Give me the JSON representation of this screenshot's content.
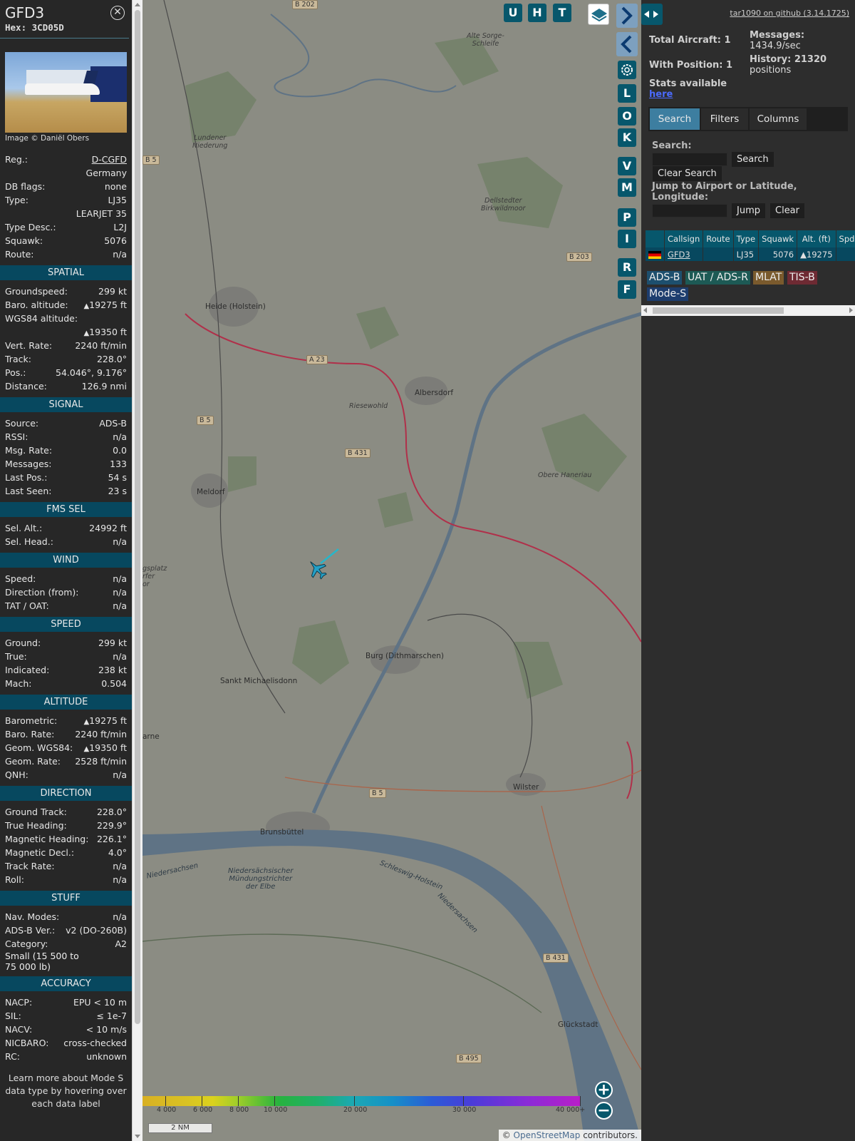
{
  "aircraft": {
    "callsign": "GFD3",
    "hex_label": "Hex:",
    "hex": "3CD05D",
    "photo_caption": "Image © Daniël Obers"
  },
  "info": [
    {
      "k": "Reg.:",
      "v": "D-CGFD",
      "link": true
    },
    {
      "k": "",
      "v": "Germany"
    },
    {
      "k": "DB flags:",
      "v": "none"
    },
    {
      "k": "Type:",
      "v": "LJ35"
    },
    {
      "k": "",
      "v": "LEARJET 35"
    },
    {
      "k": "Type Desc.:",
      "v": "L2J"
    },
    {
      "k": "Squawk:",
      "v": "5076"
    },
    {
      "k": "Route:",
      "v": "n/a"
    }
  ],
  "sections": {
    "spatial": {
      "title": "SPATIAL",
      "rows": [
        {
          "k": "Groundspeed:",
          "v": "299 kt"
        },
        {
          "k": "Baro. altitude:",
          "v": "▲19275 ft"
        },
        {
          "k": "WGS84 altitude:",
          "v": ""
        },
        {
          "k": "",
          "v": "▲19350 ft"
        },
        {
          "k": "Vert. Rate:",
          "v": "2240 ft/min"
        },
        {
          "k": "Track:",
          "v": "228.0°"
        },
        {
          "k": "Pos.:",
          "v": "54.046°, 9.176°"
        },
        {
          "k": "Distance:",
          "v": "126.9 nmi"
        }
      ]
    },
    "signal": {
      "title": "SIGNAL",
      "rows": [
        {
          "k": "Source:",
          "v": "ADS-B"
        },
        {
          "k": "RSSI:",
          "v": "n/a"
        },
        {
          "k": "Msg. Rate:",
          "v": "0.0"
        },
        {
          "k": "Messages:",
          "v": "133"
        },
        {
          "k": "Last Pos.:",
          "v": "54 s"
        },
        {
          "k": "Last Seen:",
          "v": "23 s"
        }
      ]
    },
    "fms": {
      "title": "FMS SEL",
      "rows": [
        {
          "k": "Sel. Alt.:",
          "v": "24992 ft"
        },
        {
          "k": "Sel. Head.:",
          "v": "n/a"
        }
      ]
    },
    "wind": {
      "title": "WIND",
      "rows": [
        {
          "k": "Speed:",
          "v": "n/a"
        },
        {
          "k": "Direction (from):",
          "v": "n/a"
        },
        {
          "k": "TAT / OAT:",
          "v": "n/a"
        }
      ]
    },
    "speed": {
      "title": "SPEED",
      "rows": [
        {
          "k": "Ground:",
          "v": "299 kt"
        },
        {
          "k": "True:",
          "v": "n/a"
        },
        {
          "k": "Indicated:",
          "v": "238 kt"
        },
        {
          "k": "Mach:",
          "v": "0.504"
        }
      ]
    },
    "altitude": {
      "title": "ALTITUDE",
      "rows": [
        {
          "k": "Barometric:",
          "v": "▲19275 ft"
        },
        {
          "k": "Baro. Rate:",
          "v": "2240 ft/min"
        },
        {
          "k": "Geom. WGS84:",
          "v": "▲19350 ft"
        },
        {
          "k": "Geom. Rate:",
          "v": "2528 ft/min"
        },
        {
          "k": "QNH:",
          "v": "n/a"
        }
      ]
    },
    "direction": {
      "title": "DIRECTION",
      "rows": [
        {
          "k": "Ground Track:",
          "v": "228.0°"
        },
        {
          "k": "True Heading:",
          "v": "229.9°"
        },
        {
          "k": "Magnetic Heading:",
          "v": "226.1°"
        },
        {
          "k": "Magnetic Decl.:",
          "v": "4.0°"
        },
        {
          "k": "Track Rate:",
          "v": "n/a"
        },
        {
          "k": "Roll:",
          "v": "n/a"
        }
      ]
    },
    "stuff": {
      "title": "STUFF",
      "rows": [
        {
          "k": "Nav. Modes:",
          "v": "n/a"
        },
        {
          "k": "ADS-B Ver.:",
          "v": "v2 (DO-260B)"
        },
        {
          "k": "Category:",
          "v": "A2"
        }
      ],
      "category_desc": "Small (15 500 to 75 000 lb)"
    },
    "accuracy": {
      "title": "ACCURACY",
      "rows": [
        {
          "k": "NACP:",
          "v": "EPU < 10 m"
        },
        {
          "k": "SIL:",
          "v": "≤ 1e-7"
        },
        {
          "k": "NACV:",
          "v": "< 10 m/s"
        },
        {
          "k": "NICBARO:",
          "v": "cross-checked"
        },
        {
          "k": "RC:",
          "v": "unknown"
        }
      ]
    }
  },
  "learn_more": "Learn more about Mode S data type by hovering over each data label",
  "map": {
    "buttons": [
      "U",
      "H",
      "T",
      "L",
      "O",
      "K",
      "V",
      "M",
      "P",
      "I",
      "R",
      "F"
    ],
    "places": {
      "heide": "Heide (Holstein)",
      "albersdorf": "Albersdorf",
      "meldorf": "Meldorf",
      "burg": "Burg (Dithmarschen)",
      "sankt": "Sankt Michaelisdonn",
      "wilster": "Wilster",
      "brunsbuettel": "Brunsbüttel",
      "glueckstadt": "Glückstadt",
      "marne": "arne",
      "lundener": "Lundener\nNiederung",
      "riesewohld": "Riesewohld",
      "dellstedter": "Dellstedter\nBirkwildmoor",
      "alte": "Alte Sorge-\nSchleife",
      "obere": "Obere Haneriau",
      "elbe": "Niedersächsischer\nMündungstrichter\nder Elbe",
      "sh": "Schleswig-Holstein",
      "nds1": "Niedersachsen",
      "nds2": "Niedersachsen",
      "platz": "gsplatz\nrfer\nor"
    },
    "roads": {
      "b202": "B 202",
      "b203": "B 203",
      "a23": "A 23",
      "b5a": "B 5",
      "b5b": "B 5",
      "b431a": "B 431",
      "b431b": "B 431",
      "b495": "B 495",
      "b5c": "B 5"
    },
    "legend_labels": [
      "4 000",
      "6 000",
      "8 000",
      "10 000",
      "20 000",
      "30 000",
      "40 000+"
    ],
    "scale": "2 NM",
    "attribution_prefix": "© ",
    "attribution_link": "OpenStreetMap",
    "attribution_suffix": " contributors."
  },
  "sidebar": {
    "github": "tar1090 on github (3.14.1725)",
    "total_aircraft": "Total Aircraft: 1",
    "with_position": "With Position: 1",
    "stats_text": "Stats available",
    "stats_link": "here",
    "messages_label": "Messages:",
    "messages_rate": "1434.9/sec",
    "history_label": "History: 21320",
    "history_sub": "positions",
    "tabs": [
      "Search",
      "Filters",
      "Columns"
    ],
    "search_label": "Search:",
    "search_button": "Search",
    "clear_search": "Clear Search",
    "jump_label": "Jump to Airport or Latitude, Longitude:",
    "jump_button": "Jump",
    "clear_button": "Clear",
    "table_headers": [
      "",
      "Callsign",
      "Route",
      "Type",
      "Squawk",
      "Alt. (ft)",
      "Spd"
    ],
    "table_row": {
      "callsign": "GFD3",
      "route": "",
      "type": "LJ35",
      "squawk": "5076",
      "alt": "▲19275",
      "spd": ""
    },
    "sources": [
      {
        "label": "ADS-B",
        "color": "#1d4f6e"
      },
      {
        "label": "UAT / ADS-R",
        "color": "#1d5a55"
      },
      {
        "label": "MLAT",
        "color": "#7a5a2d"
      },
      {
        "label": "TIS-B",
        "color": "#6e2a33"
      },
      {
        "label": "Mode-S",
        "color": "#1d3d6e"
      }
    ]
  }
}
